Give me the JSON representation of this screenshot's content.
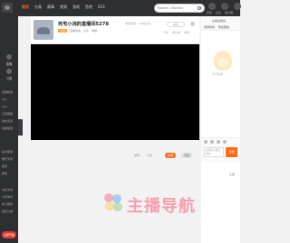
{
  "topbar": {
    "nav": [
      "首页",
      "分类",
      "赛事",
      "视频",
      "游戏",
      "鱼吧",
      "S1S"
    ],
    "active_index": 0,
    "search_placeholder": "Search - Monitor",
    "icons": [
      "history-icon",
      "follow-icon",
      "download-icon"
    ],
    "labels": [
      "历史",
      "关注",
      "客户端"
    ]
  },
  "sidebar": {
    "items": [
      {
        "icon": "live-icon",
        "label": "直播"
      },
      {
        "icon": "category-icon",
        "label": "分类"
      }
    ],
    "sub_items": [
      "直播精选",
      "LOL",
      "CS2",
      "王者荣耀",
      "永劫无间",
      "英雄联盟"
    ],
    "lower_items": [
      "鱼乐星球",
      "娱乐天地",
      "星秀",
      "颜值"
    ],
    "bottom_items": [
      "文化天地",
      "户外体育",
      "热门推荐",
      "更多分类"
    ],
    "cta_label": "立即开播"
  },
  "room": {
    "title": "死宅小浣的直播间5278",
    "subtitle": "网络游戏 > 永劫无间",
    "tag": "主播",
    "meta": [
      "直播动态",
      "分享",
      "举报"
    ],
    "header_button": "关注",
    "actions": [
      "分享",
      "客户端",
      "举报"
    ]
  },
  "player_controls": {
    "items": [
      "弹幕",
      "礼物"
    ],
    "orange_button": "充值",
    "gray_button": "背包"
  },
  "right_panel": {
    "title": "主播勋章榜",
    "tabs": [
      "贡献周榜",
      "粉丝团榜"
    ],
    "mascot_label": "暂无数据",
    "chat_placeholder": "这里输入聊天内容",
    "send_label": "发送",
    "bottom_label": "主播"
  },
  "watermark": {
    "text": "主播导航"
  }
}
